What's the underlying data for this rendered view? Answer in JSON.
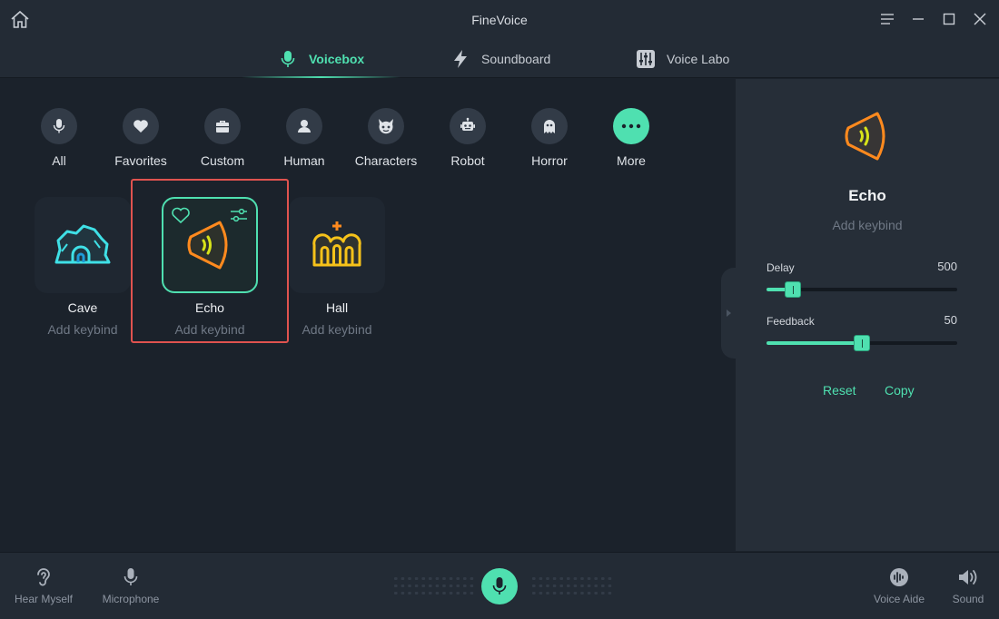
{
  "window": {
    "title": "FineVoice"
  },
  "tabs": [
    {
      "label": "Voicebox",
      "icon": "microphone-icon",
      "active": true
    },
    {
      "label": "Soundboard",
      "icon": "lightning-icon",
      "active": false
    },
    {
      "label": "Voice Labo",
      "icon": "equalizer-icon",
      "active": false
    }
  ],
  "categories": [
    {
      "label": "All",
      "icon": "microphone-icon"
    },
    {
      "label": "Favorites",
      "icon": "heart-icon"
    },
    {
      "label": "Custom",
      "icon": "briefcase-icon"
    },
    {
      "label": "Human",
      "icon": "person-icon"
    },
    {
      "label": "Characters",
      "icon": "devil-icon"
    },
    {
      "label": "Robot",
      "icon": "robot-icon"
    },
    {
      "label": "Horror",
      "icon": "ghost-icon"
    },
    {
      "label": "More",
      "icon": "more-dots-icon"
    }
  ],
  "voices": [
    {
      "name": "Cave",
      "keybind": "Add keybind",
      "icon": "cave-icon",
      "color": "#3fe0e6"
    },
    {
      "name": "Echo",
      "keybind": "Add keybind",
      "icon": "echo-speaker-icon",
      "color": "#ff8a1e",
      "selected": true
    },
    {
      "name": "Hall",
      "keybind": "Add keybind",
      "icon": "hall-icon",
      "color": "#f6c21a"
    }
  ],
  "panel": {
    "name": "Echo",
    "keybind": "Add keybind",
    "sliders": [
      {
        "label": "Delay",
        "value": "500",
        "level": 0.14
      },
      {
        "label": "Feedback",
        "value": "50",
        "level": 0.5
      }
    ],
    "reset_label": "Reset",
    "copy_label": "Copy"
  },
  "bottom": {
    "hear_myself": "Hear Myself",
    "microphone": "Microphone",
    "voice_aide": "Voice Aide",
    "sound": "Sound"
  },
  "colors": {
    "accent": "#4fe0b0",
    "highlight": "#e0534f",
    "background": "#1b222b"
  }
}
